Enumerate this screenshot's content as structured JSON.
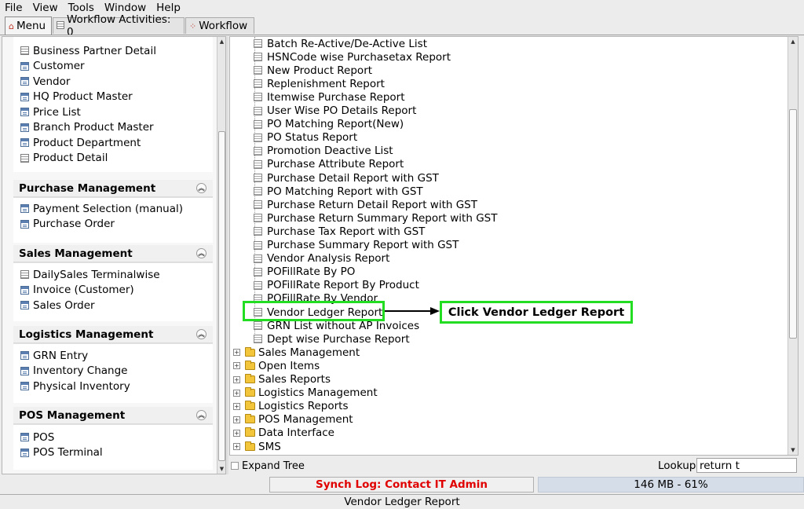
{
  "menubar": [
    {
      "label": "File"
    },
    {
      "label": "View"
    },
    {
      "label": "Tools"
    },
    {
      "label": "Window"
    },
    {
      "label": "Help"
    }
  ],
  "tabs": [
    {
      "label": "Menu",
      "icon": "home-icon"
    },
    {
      "label": "Workflow Activities: 0",
      "icon": "document-icon"
    },
    {
      "label": "Workflow",
      "icon": "workflow-icon"
    }
  ],
  "left": {
    "top_items": [
      {
        "label": "Business Partner Detail",
        "icon": "document-icon"
      },
      {
        "label": "Customer",
        "icon": "window-icon"
      },
      {
        "label": "Vendor",
        "icon": "window-icon"
      },
      {
        "label": "HQ Product Master",
        "icon": "window-icon"
      },
      {
        "label": "Price List",
        "icon": "window-icon"
      },
      {
        "label": "Branch Product Master",
        "icon": "window-icon"
      },
      {
        "label": "Product Department",
        "icon": "window-icon"
      },
      {
        "label": "Product Detail",
        "icon": "document-icon"
      }
    ],
    "groups": [
      {
        "title": "Purchase Management",
        "items": [
          {
            "label": "Payment Selection (manual)",
            "icon": "window-icon"
          },
          {
            "label": "Purchase Order",
            "icon": "window-icon"
          }
        ]
      },
      {
        "title": "Sales Management",
        "items": [
          {
            "label": "DailySales Terminalwise",
            "icon": "document-icon"
          },
          {
            "label": "Invoice (Customer)",
            "icon": "window-icon"
          },
          {
            "label": "Sales Order",
            "icon": "window-icon"
          }
        ]
      },
      {
        "title": "Logistics Management",
        "items": [
          {
            "label": "GRN Entry",
            "icon": "window-icon"
          },
          {
            "label": "Inventory Change",
            "icon": "window-icon"
          },
          {
            "label": "Physical Inventory",
            "icon": "window-icon"
          }
        ]
      },
      {
        "title": "POS Management",
        "items": [
          {
            "label": "POS",
            "icon": "window-icon"
          },
          {
            "label": "POS Terminal",
            "icon": "window-icon"
          }
        ]
      }
    ]
  },
  "tree": {
    "leaves": [
      "Batch Re-Active/De-Active List",
      "HSNCode wise Purchasetax Report",
      "New Product Report",
      "Replenishment Report",
      "Itemwise Purchase Report",
      "User Wise PO Details Report",
      "PO Matching Report(New)",
      "PO Status Report",
      "Promotion Deactive List",
      "Purchase Attribute Report",
      "Purchase Detail Report with GST",
      "PO Matching Report with GST",
      "Purchase Return Detail Report with GST",
      "Purchase Return Summary Report with GST",
      "Purchase Tax Report with GST",
      "Purchase Summary Report with GST",
      "Vendor Analysis Report",
      "POFillRate By PO",
      "POFillRate Report By Product",
      "POFillRate By Vendor",
      "Vendor Ledger Report",
      "GRN List without AP Invoices",
      "Dept wise Purchase Report"
    ],
    "folders": [
      "Sales Management",
      "Open Items",
      "Sales Reports",
      "Logistics Management",
      "Logistics Reports",
      "POS Management",
      "Data Interface",
      "SMS"
    ]
  },
  "annotation": {
    "callout_text": "Click Vendor Ledger Report",
    "highlight_color": "#22dd22"
  },
  "bottom": {
    "expand_tree_label": "Expand Tree",
    "lookup_label": "Lookup",
    "lookup_value": "return t"
  },
  "status": {
    "synch_log": "Synch Log: Contact IT Admin",
    "memory": "146 MB - 61%",
    "statusbar_text": "Vendor Ledger Report"
  }
}
